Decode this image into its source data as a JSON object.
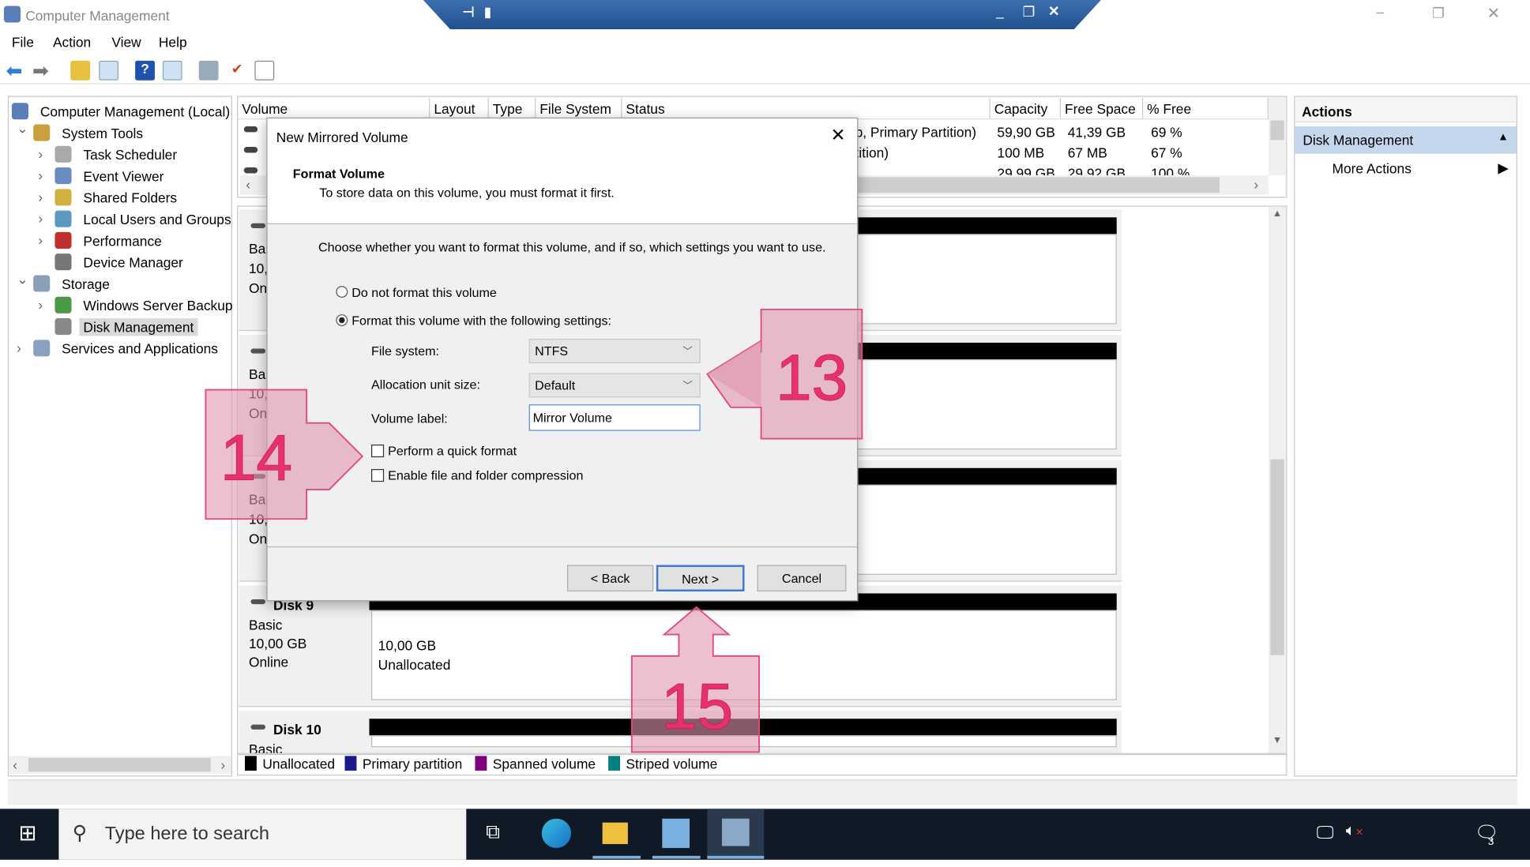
{
  "window": {
    "title": "Computer Management",
    "menu": [
      "File",
      "Action",
      "View",
      "Help"
    ]
  },
  "tree": {
    "items": [
      {
        "label": "Computer Management (Local)",
        "level": 0
      },
      {
        "label": "System Tools",
        "level": 1,
        "expanded": true
      },
      {
        "label": "Task Scheduler",
        "level": 2
      },
      {
        "label": "Event Viewer",
        "level": 2
      },
      {
        "label": "Shared Folders",
        "level": 2
      },
      {
        "label": "Local Users and Groups",
        "level": 2
      },
      {
        "label": "Performance",
        "level": 2
      },
      {
        "label": "Device Manager",
        "level": 2
      },
      {
        "label": "Storage",
        "level": 1,
        "expanded": true
      },
      {
        "label": "Windows Server Backup",
        "level": 2
      },
      {
        "label": "Disk Management",
        "level": 2,
        "selected": true
      },
      {
        "label": "Services and Applications",
        "level": 1
      }
    ]
  },
  "volumes": {
    "columns": [
      "Volume",
      "Layout",
      "Type",
      "File System",
      "Status",
      "Capacity",
      "Free Space",
      "% Free"
    ],
    "rows": [
      {
        "status": "p, Primary Partition)",
        "capacity": "59,90 GB",
        "free": "41,39 GB",
        "pct": "69 %"
      },
      {
        "status": "tition)",
        "capacity": "100 MB",
        "free": "67 MB",
        "pct": "67 %"
      },
      {
        "status": "",
        "capacity": "29,99 GB",
        "free": "29,92 GB",
        "pct": "100 %"
      }
    ]
  },
  "disks": {
    "partial": [
      {
        "l1": "Bas",
        "l2": "10,",
        "l3": "On"
      },
      {
        "l1": "Bas",
        "l2": "10,",
        "l3": "On"
      },
      {
        "l1": "Bas",
        "l2": "10,",
        "l3": "On"
      }
    ],
    "disk9": {
      "name": "Disk 9",
      "type": "Basic",
      "size": "10,00 GB",
      "state": "Online",
      "part_size": "10,00 GB",
      "part_state": "Unallocated"
    },
    "disk10": {
      "name": "Disk 10",
      "type": "Basic"
    }
  },
  "legend": [
    {
      "label": "Unallocated",
      "color": "#000000"
    },
    {
      "label": "Primary partition",
      "color": "#1a1a8c"
    },
    {
      "label": "Spanned volume",
      "color": "#800080"
    },
    {
      "label": "Striped volume",
      "color": "#008080"
    }
  ],
  "actions": {
    "title": "Actions",
    "section": "Disk Management",
    "more": "More Actions"
  },
  "dialog": {
    "title": "New Mirrored Volume",
    "heading": "Format Volume",
    "subheading": "To store data on this volume, you must format it first.",
    "instruction": "Choose whether you want to format this volume, and if so, which settings you want to use.",
    "radio_no": "Do not format this volume",
    "radio_yes": "Format this volume with the following settings:",
    "selected_option": "format",
    "fs_label": "File system:",
    "fs_value": "NTFS",
    "alloc_label": "Allocation unit size:",
    "alloc_value": "Default",
    "vol_label": "Volume label:",
    "vol_value": "Mirror Volume",
    "quick_format": "Perform a quick format",
    "quick_checked": false,
    "compression": "Enable file and folder compression",
    "compression_checked": false,
    "back": "< Back",
    "next": "Next >",
    "cancel": "Cancel"
  },
  "annotations": [
    "13",
    "14",
    "15"
  ],
  "taskbar": {
    "search_placeholder": "Type here to search",
    "notification_count": "3"
  }
}
